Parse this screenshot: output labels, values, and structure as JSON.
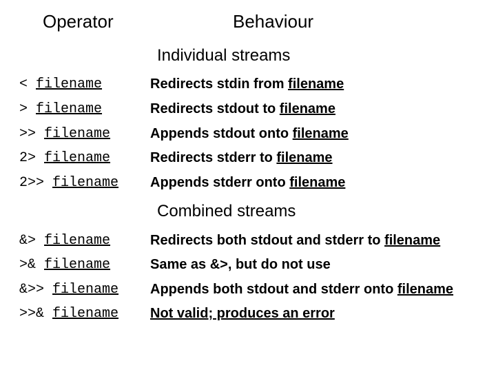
{
  "headers": {
    "operator": "Operator",
    "behaviour": "Behaviour"
  },
  "sections": {
    "individual": "Individual streams",
    "combined": "Combined streams"
  },
  "rows": {
    "ind": [
      {
        "op_pre": "< ",
        "op_link": "filename",
        "be_pre": "Redirects stdin from ",
        "be_link": "filename",
        "be_post": ""
      },
      {
        "op_pre": "> ",
        "op_link": "filename",
        "be_pre": "Redirects stdout to ",
        "be_link": "filename",
        "be_post": ""
      },
      {
        "op_pre": ">> ",
        "op_link": "filename",
        "be_pre": "Appends stdout onto ",
        "be_link": "filename",
        "be_post": ""
      },
      {
        "op_pre": "2> ",
        "op_link": "filename",
        "be_pre": "Redirects stderr to ",
        "be_link": "filename",
        "be_post": ""
      },
      {
        "op_pre": "2>> ",
        "op_link": "filename",
        "be_pre": "Appends stderr onto ",
        "be_link": "filename",
        "be_post": ""
      }
    ],
    "com": [
      {
        "op_pre": "&> ",
        "op_link": "filename",
        "be_pre": "Redirects both stdout and stderr to ",
        "be_link": "filename",
        "be_post": ""
      },
      {
        "op_pre": ">& ",
        "op_link": "filename",
        "be_pre": "Same as &>, but do not use",
        "be_link": "",
        "be_post": ""
      },
      {
        "op_pre": "&>> ",
        "op_link": "filename",
        "be_pre": "Appends both stdout and stderr onto ",
        "be_link": "filename",
        "be_post": ""
      },
      {
        "op_pre": ">>& ",
        "op_link": "filename",
        "be_pre": "Not valid; produces an error",
        "be_link": "",
        "be_post": ""
      }
    ]
  }
}
